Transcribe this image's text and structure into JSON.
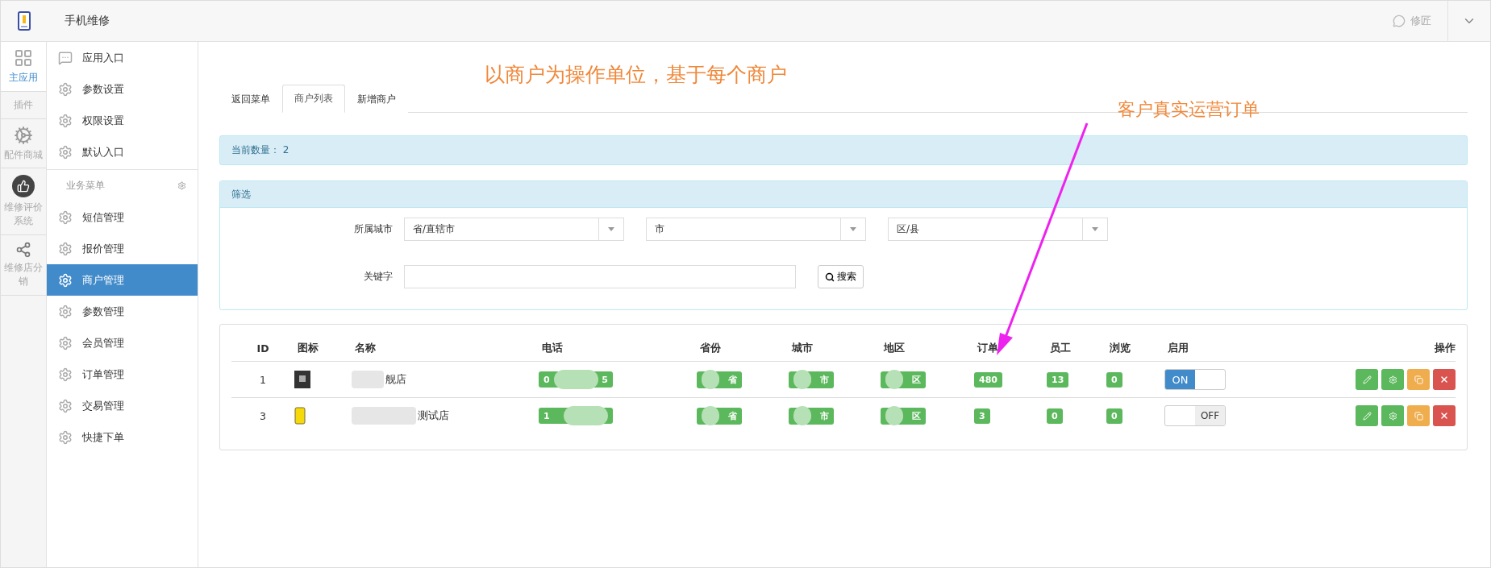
{
  "header": {
    "app_title": "手机维修",
    "user": "修匠"
  },
  "rail": [
    {
      "label": "主应用",
      "selected": true,
      "kind": "apps"
    },
    {
      "label": "插件",
      "selected": false,
      "kind": "section"
    },
    {
      "label": "配件商城",
      "selected": false,
      "kind": "gear"
    },
    {
      "label": "维修评价系统",
      "selected": false,
      "kind": "thumb"
    },
    {
      "label": "维修店分销",
      "selected": false,
      "kind": "network"
    }
  ],
  "menu_top": [
    {
      "label": "应用入口",
      "kind": "chat"
    },
    {
      "label": "参数设置",
      "kind": "gear"
    },
    {
      "label": "权限设置",
      "kind": "gear"
    },
    {
      "label": "默认入口",
      "kind": "gear"
    }
  ],
  "menu_section": "业务菜单",
  "menu_items": [
    {
      "label": "短信管理",
      "selected": false
    },
    {
      "label": "报价管理",
      "selected": false
    },
    {
      "label": "商户管理",
      "selected": true
    },
    {
      "label": "参数管理",
      "selected": false
    },
    {
      "label": "会员管理",
      "selected": false
    },
    {
      "label": "订单管理",
      "selected": false
    },
    {
      "label": "交易管理",
      "selected": false
    },
    {
      "label": "快捷下单",
      "selected": false
    }
  ],
  "tabs": [
    {
      "label": "返回菜单",
      "selected": false
    },
    {
      "label": "商户列表",
      "selected": true
    },
    {
      "label": "新增商户",
      "selected": false
    }
  ],
  "count": {
    "label": "当前数量：",
    "value": "2"
  },
  "filter": {
    "title": "筛选",
    "city_label": "所属城市",
    "selects": [
      "省/直辖市",
      "市",
      "区/县"
    ],
    "keyword_label": "关键字",
    "search_button": "搜索"
  },
  "table": {
    "columns": [
      "ID",
      "图标",
      "名称",
      "电话",
      "省份",
      "城市",
      "地区",
      "订单",
      "员工",
      "浏览",
      "启用",
      "操作"
    ],
    "rows": [
      {
        "id": "1",
        "kind": "dark",
        "name": "舰店",
        "phone": {
          "head": "0",
          "tail": "5"
        },
        "province": {
          "tail": "省"
        },
        "city": {
          "tail": "市"
        },
        "district": {
          "tail": "区"
        },
        "orders": "480",
        "staff": "13",
        "views": "0",
        "enabled": true,
        "toggle": "ON"
      },
      {
        "id": "3",
        "kind": "phone",
        "name": "测试店",
        "phone": {
          "head": "1"
        },
        "province": {
          "tail": "省"
        },
        "city": {
          "tail": "市"
        },
        "district": {
          "tail": "区"
        },
        "orders": "3",
        "staff": "0",
        "views": "0",
        "enabled": false,
        "toggle": "OFF"
      }
    ]
  },
  "annotations": [
    {
      "text": "以商户为操作单位，基于每个商户",
      "kind": "note"
    },
    {
      "text": "客户真实运营订单",
      "kind": "arrow"
    }
  ]
}
